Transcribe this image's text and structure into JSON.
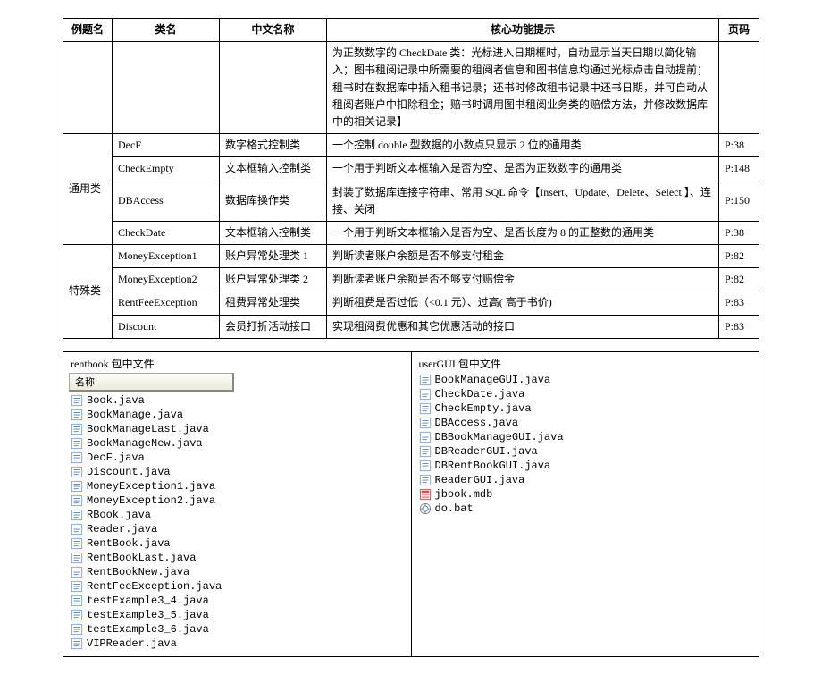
{
  "table": {
    "headers": {
      "example": "例题名",
      "class": "类名",
      "cnname": "中文名称",
      "hint": "核心功能提示",
      "page": "页码"
    },
    "big_hint": "为正数数字的 CheckDate 类：光标进入日期框时，自动显示当天日期以简化输入；图书租阅记录中所需要的租阅者信息和图书信息均通过光标点击自动提前；租书时在数据库中插入租书记录；还书时修改租书记录中还书日期，并可自动从租阅者账户中扣除租金；赔书时调用图书租阅业务类的赔偿方法，并修改数据库中的相关记录】",
    "groups": [
      {
        "label": "通用类",
        "rows": [
          {
            "class": "DecF",
            "cn": "数字格式控制类",
            "hint": "一个控制 double 型数据的小数点只显示 2 位的通用类",
            "page": "P:38"
          },
          {
            "class": "CheckEmpty",
            "cn": "文本框输入控制类",
            "hint": "一个用于判断文本框输入是否为空、是否为正数数字的通用类",
            "page": "P:148"
          },
          {
            "class": "DBAccess",
            "cn": "数据库操作类",
            "hint": "封装了数据库连接字符串、常用 SQL 命令【Insert、Update、Delete、Select 】、连接、关闭",
            "page": "P:150"
          },
          {
            "class": "CheckDate",
            "cn": "文本框输入控制类",
            "hint": "一个用于判断文本框输入是否为空、是否长度为 8 的正整数的通用类",
            "page": "P:38"
          }
        ]
      },
      {
        "label": "特殊类",
        "rows": [
          {
            "class": "MoneyException1",
            "cn": "账户异常处理类 1",
            "hint": "判断读者账户余额是否不够支付租金",
            "page": "P:82"
          },
          {
            "class": "MoneyException2",
            "cn": "账户异常处理类 2",
            "hint": "判断读者账户余额是否不够支付赔偿金",
            "page": "P:82"
          },
          {
            "class": "RentFeeException",
            "cn": "租费异常处理类",
            "hint": "判断租费是否过低（<0.1 元）、过高( 高于书价)",
            "page": "P:83"
          },
          {
            "class": "Discount",
            "cn": "会员打折活动接口",
            "hint": "实现租阅费优惠和其它优惠活动的接口",
            "page": "P:83"
          }
        ]
      }
    ]
  },
  "panels": {
    "left": {
      "title": "rentbook 包中文件",
      "name_header": "名称",
      "files": [
        {
          "name": "Book.java",
          "type": "java"
        },
        {
          "name": "BookManage.java",
          "type": "java"
        },
        {
          "name": "BookManageLast.java",
          "type": "java"
        },
        {
          "name": "BookManageNew.java",
          "type": "java"
        },
        {
          "name": "DecF.java",
          "type": "java"
        },
        {
          "name": "Discount.java",
          "type": "java"
        },
        {
          "name": "MoneyException1.java",
          "type": "java"
        },
        {
          "name": "MoneyException2.java",
          "type": "java"
        },
        {
          "name": "RBook.java",
          "type": "java"
        },
        {
          "name": "Reader.java",
          "type": "java"
        },
        {
          "name": "RentBook.java",
          "type": "java"
        },
        {
          "name": "RentBookLast.java",
          "type": "java"
        },
        {
          "name": "RentBookNew.java",
          "type": "java"
        },
        {
          "name": "RentFeeException.java",
          "type": "java"
        },
        {
          "name": "testExample3_4.java",
          "type": "java"
        },
        {
          "name": "testExample3_5.java",
          "type": "java"
        },
        {
          "name": "testExample3_6.java",
          "type": "java"
        },
        {
          "name": "VIPReader.java",
          "type": "java"
        }
      ]
    },
    "right": {
      "title": "userGUI 包中文件",
      "files": [
        {
          "name": "BookManageGUI.java",
          "type": "java"
        },
        {
          "name": "CheckDate.java",
          "type": "java"
        },
        {
          "name": "CheckEmpty.java",
          "type": "java"
        },
        {
          "name": "DBAccess.java",
          "type": "java"
        },
        {
          "name": "DBBookManageGUI.java",
          "type": "java"
        },
        {
          "name": "DBReaderGUI.java",
          "type": "java"
        },
        {
          "name": "DBRentBookGUI.java",
          "type": "java"
        },
        {
          "name": "ReaderGUI.java",
          "type": "java"
        },
        {
          "name": "jbook.mdb",
          "type": "mdb"
        },
        {
          "name": "do.bat",
          "type": "bat"
        }
      ]
    }
  }
}
